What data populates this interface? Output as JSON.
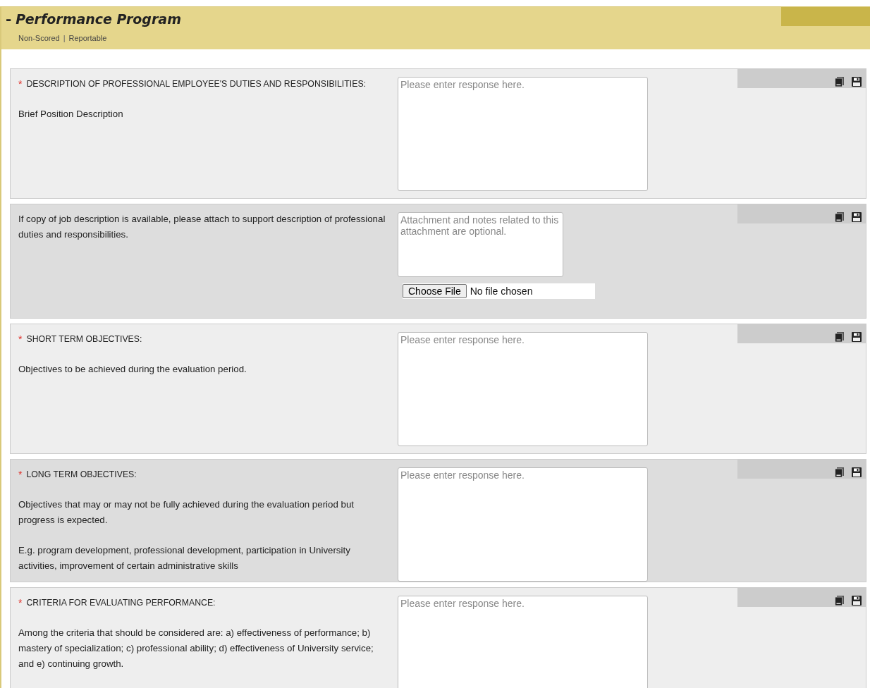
{
  "header": {
    "toggle": "-",
    "title": "Performance Program",
    "meta": [
      "Non-Scored",
      "Reportable"
    ],
    "separator": "|"
  },
  "required_mark": "*",
  "sections": [
    {
      "kind": "response",
      "required": true,
      "title": "DESCRIPTION OF PROFESSIONAL EMPLOYEE'S DUTIES AND RESPONSIBILITIES:",
      "paragraphs": [
        "Brief Position Description"
      ],
      "placeholder": "Please enter response here."
    },
    {
      "kind": "attachment",
      "paragraphs": [
        "If copy of job description is available, please attach to support description of professional duties and responsibilities."
      ],
      "placeholder": "Attachment and notes related to this attachment are optional.",
      "file_button": "Choose File",
      "file_status": "No file chosen"
    },
    {
      "kind": "response",
      "required": true,
      "title": "SHORT TERM OBJECTIVES:",
      "paragraphs": [
        "Objectives to be achieved during the evaluation period."
      ],
      "placeholder": "Please enter response here."
    },
    {
      "kind": "response",
      "required": true,
      "title": "LONG TERM OBJECTIVES:",
      "paragraphs": [
        "Objectives that may or may not be fully achieved during the evaluation period but progress is expected.",
        "E.g. program development, professional development, participation in University activities, improvement of certain administrative skills"
      ],
      "placeholder": "Please enter response here."
    },
    {
      "kind": "response",
      "required": true,
      "title": "CRITERIA FOR EVALUATING PERFORMANCE:",
      "paragraphs": [
        "Among the criteria that should be considered are: a) effectiveness of performance; b) mastery of specialization; c) professional ability; d) effectiveness of University service; and e) continuing growth."
      ],
      "placeholder": "Please enter response here."
    }
  ]
}
